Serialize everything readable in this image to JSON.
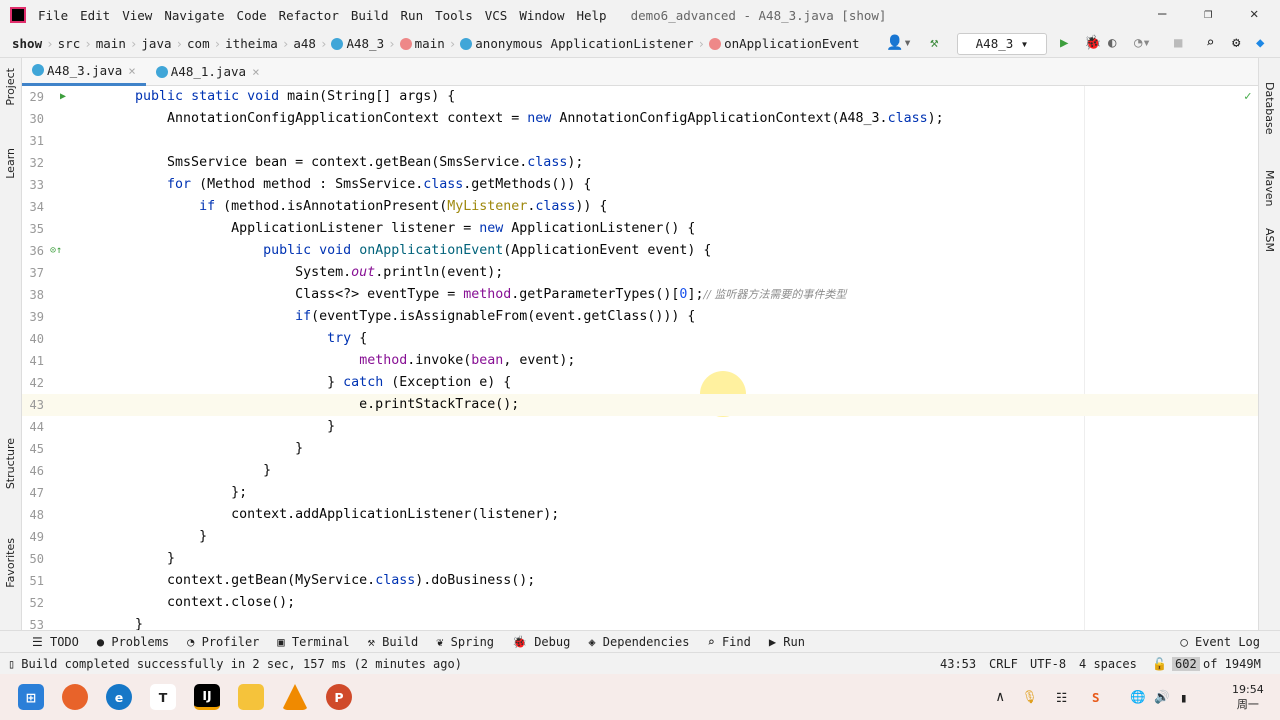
{
  "menu": {
    "items": [
      "File",
      "Edit",
      "View",
      "Navigate",
      "Code",
      "Refactor",
      "Build",
      "Run",
      "Tools",
      "VCS",
      "Window",
      "Help"
    ],
    "title": "demo6_advanced - A48_3.java [show]"
  },
  "breadcrumbs": [
    "show",
    "src",
    "main",
    "java",
    "com",
    "itheima",
    "a48",
    "A48_3",
    "main",
    "anonymous ApplicationListener",
    "onApplicationEvent"
  ],
  "toolbar": {
    "run_config": "A48_3"
  },
  "tabs": [
    {
      "label": "A48_3.java",
      "active": true
    },
    {
      "label": "A48_1.java",
      "active": false
    }
  ],
  "left_strip": [
    "Project",
    "Learn",
    "Structure",
    "Favorites"
  ],
  "right_strip": [
    "Database",
    "Maven",
    "ASM"
  ],
  "editor": {
    "current_line": 43,
    "lines": [
      {
        "n": 29,
        "t": [
          [
            "    "
          ],
          [
            "public static void ",
            "kw"
          ],
          [
            "main(String[] args) {"
          ]
        ]
      },
      {
        "n": 30,
        "t": [
          [
            "        AnnotationConfigApplicationContext context = "
          ],
          [
            "new ",
            "kw"
          ],
          [
            "AnnotationConfigApplicationContext(A48_3."
          ],
          [
            "class",
            "kw"
          ],
          [
            ");"
          ]
        ]
      },
      {
        "n": 31,
        "t": [
          [
            ""
          ]
        ]
      },
      {
        "n": 32,
        "t": [
          [
            "        SmsService bean = context.getBean(SmsService."
          ],
          [
            "class",
            "kw"
          ],
          [
            ");"
          ]
        ]
      },
      {
        "n": 33,
        "t": [
          [
            "        "
          ],
          [
            "for ",
            "kw"
          ],
          [
            "(Method method : SmsService."
          ],
          [
            "class",
            "kw"
          ],
          [
            ".getMethods()) {"
          ]
        ]
      },
      {
        "n": 34,
        "t": [
          [
            "            "
          ],
          [
            "if ",
            "kw"
          ],
          [
            "(method.isAnnotationPresent("
          ],
          [
            "MyListener",
            "ann"
          ],
          [
            "."
          ],
          [
            "class",
            "kw"
          ],
          [
            ")) {"
          ]
        ]
      },
      {
        "n": 35,
        "t": [
          [
            "                ApplicationListener listener = "
          ],
          [
            "new ",
            "kw"
          ],
          [
            "ApplicationListener() {"
          ]
        ]
      },
      {
        "n": 36,
        "t": [
          [
            "                    "
          ],
          [
            "public void ",
            "kw"
          ],
          [
            "onApplicationEvent",
            "mth"
          ],
          [
            "(ApplicationEvent event) {"
          ]
        ]
      },
      {
        "n": 37,
        "t": [
          [
            "                        System."
          ],
          [
            "out",
            "st"
          ],
          [
            ".println(event);"
          ]
        ]
      },
      {
        "n": 38,
        "t": [
          [
            "                        Class<?> eventType = "
          ],
          [
            "method",
            "fld"
          ],
          [
            ".getParameterTypes()["
          ],
          [
            "0",
            "num"
          ],
          [
            "];"
          ],
          [
            "// 监听器方法需要的事件类型",
            "cm"
          ]
        ]
      },
      {
        "n": 39,
        "t": [
          [
            "                        "
          ],
          [
            "if",
            "kw"
          ],
          [
            "(eventType.isAssignableFrom(event.getClass())) {"
          ]
        ]
      },
      {
        "n": 40,
        "t": [
          [
            "                            "
          ],
          [
            "try ",
            "kw"
          ],
          [
            "{"
          ]
        ]
      },
      {
        "n": 41,
        "t": [
          [
            "                                "
          ],
          [
            "method",
            "fld"
          ],
          [
            ".invoke("
          ],
          [
            "bean",
            "fld"
          ],
          [
            ", event);"
          ]
        ]
      },
      {
        "n": 42,
        "t": [
          [
            "                            } "
          ],
          [
            "catch ",
            "kw"
          ],
          [
            "(Exception e) {"
          ]
        ]
      },
      {
        "n": 43,
        "t": [
          [
            "                                e.printStackTrace();"
          ]
        ]
      },
      {
        "n": 44,
        "t": [
          [
            "                            }"
          ]
        ]
      },
      {
        "n": 45,
        "t": [
          [
            "                        }"
          ]
        ]
      },
      {
        "n": 46,
        "t": [
          [
            "                    }"
          ]
        ]
      },
      {
        "n": 47,
        "t": [
          [
            "                };"
          ]
        ]
      },
      {
        "n": 48,
        "t": [
          [
            "                context.addApplicationListener(listener);"
          ]
        ]
      },
      {
        "n": 49,
        "t": [
          [
            "            }"
          ]
        ]
      },
      {
        "n": 50,
        "t": [
          [
            "        }"
          ]
        ]
      },
      {
        "n": 51,
        "t": [
          [
            "        context.getBean(MyService."
          ],
          [
            "class",
            "kw"
          ],
          [
            ").doBusiness();"
          ]
        ]
      },
      {
        "n": 52,
        "t": [
          [
            "        context.close();"
          ]
        ]
      },
      {
        "n": 53,
        "t": [
          [
            "    }"
          ]
        ]
      }
    ]
  },
  "tool_windows": [
    "TODO",
    "Problems",
    "Profiler",
    "Terminal",
    "Build",
    "Spring",
    "Debug",
    "Dependencies",
    "Find",
    "Run"
  ],
  "event_log": "Event Log",
  "status": {
    "message": "Build completed successfully in 2 sec, 157 ms (2 minutes ago)",
    "position": "43:53",
    "line_sep": "CRLF",
    "encoding": "UTF-8",
    "indent": "4 spaces",
    "memory_used": "602",
    "memory_total": "of 1949M"
  },
  "taskbar": {
    "time": "19:54",
    "day": "周一"
  },
  "colors": {
    "accent": "#4083c9",
    "keyword": "#0033b3",
    "field": "#871094"
  }
}
